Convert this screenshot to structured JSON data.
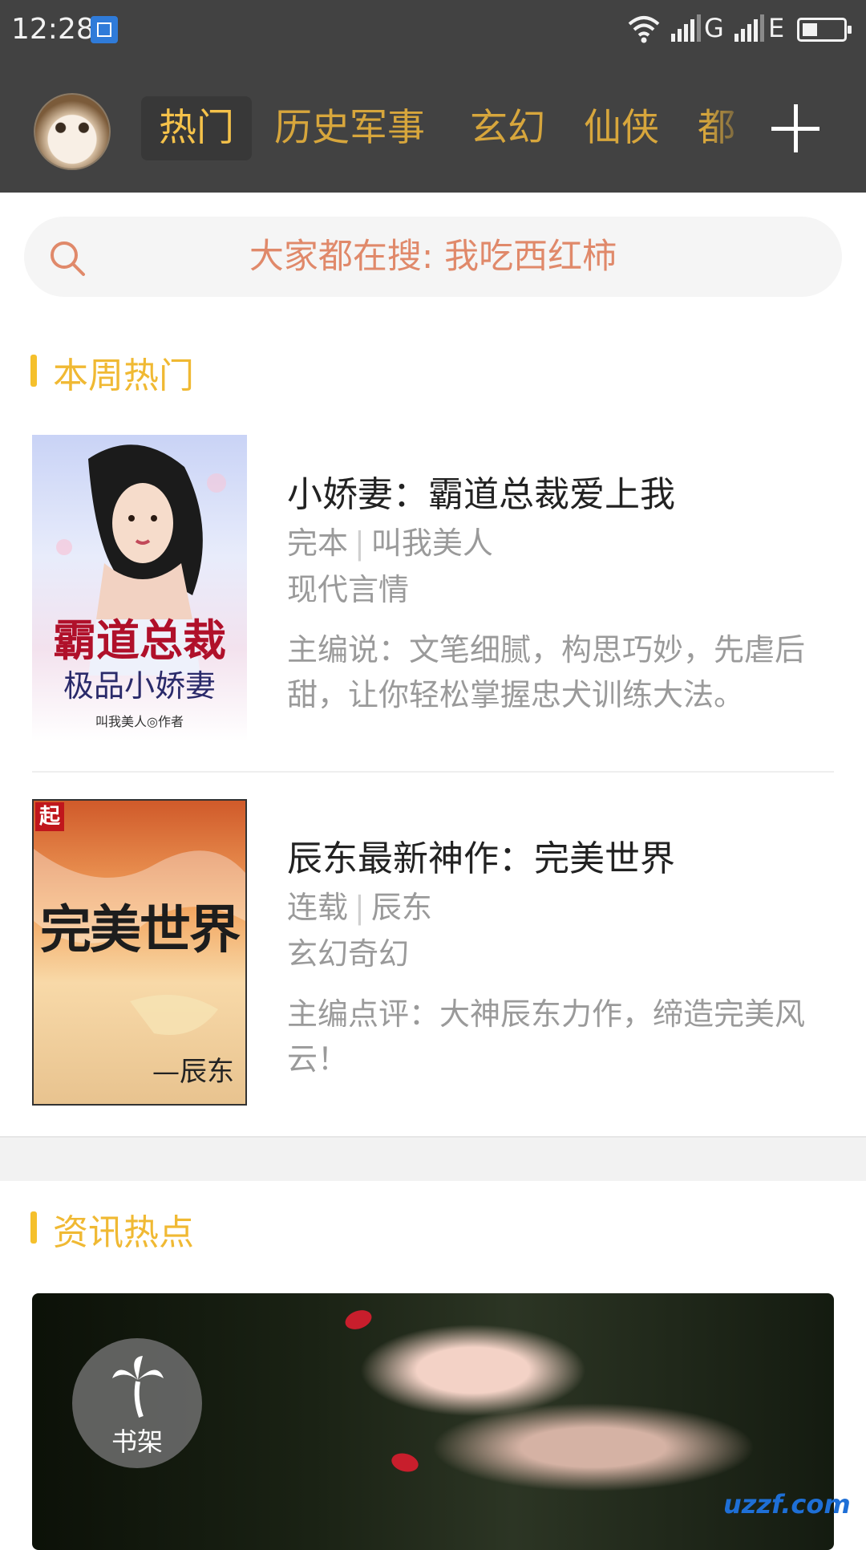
{
  "status_bar": {
    "time": "12:28",
    "network1": "G",
    "network2": "E"
  },
  "nav": {
    "tabs": [
      {
        "label": "热门",
        "active": true
      },
      {
        "label": "历史军事",
        "active": false
      },
      {
        "label": "玄幻",
        "active": false
      },
      {
        "label": "仙侠",
        "active": false
      },
      {
        "label": "都",
        "active": false
      }
    ]
  },
  "search": {
    "placeholder": "大家都在搜: 我吃西红柿"
  },
  "weekly": {
    "title": "本周热门",
    "books": [
      {
        "title": "小娇妻：霸道总裁爱上我",
        "status": "完本",
        "author": "叫我美人",
        "genre": "现代言情",
        "desc": "主编说：文笔细腻，构思巧妙，先虐后甜，让你轻松掌握忠犬训练大法。",
        "cover_title_line1": "霸道总裁",
        "cover_title_line2": "极品小娇妻",
        "cover_author": "叫我美人◎作者"
      },
      {
        "title": "辰东最新神作：完美世界",
        "status": "连载",
        "author": "辰东",
        "genre": "玄幻奇幻",
        "desc": "主编点评：大神辰东力作，缔造完美风云！",
        "cover_title": "完美世界",
        "cover_author": "—辰东",
        "cover_badge": "起"
      }
    ]
  },
  "news": {
    "title": "资讯热点"
  },
  "shelf": {
    "label": "书架"
  },
  "watermark": "uzzf.com",
  "colors": {
    "accent": "#f0b933",
    "nav_bg": "#424242",
    "search_text": "#e0896a"
  }
}
